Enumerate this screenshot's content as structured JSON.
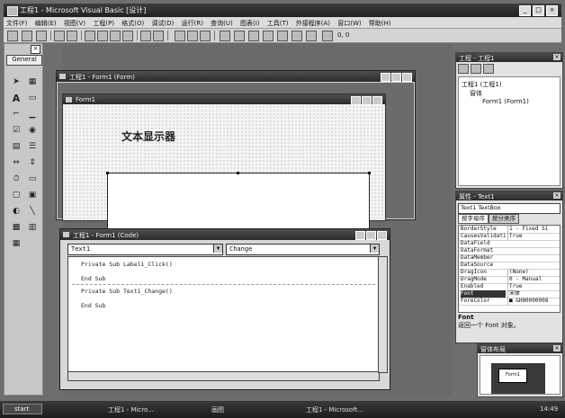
{
  "window": {
    "title": "工程1 - Microsoft Visual Basic [设计]",
    "controls": [
      "_",
      "□",
      "×"
    ]
  },
  "menu": [
    "文件(F)",
    "编辑(E)",
    "视图(V)",
    "工程(P)",
    "格式(O)",
    "调试(D)",
    "运行(R)",
    "查询(U)",
    "图表(I)",
    "工具(T)",
    "外接程序(A)",
    "窗口(W)",
    "帮助(H)"
  ],
  "toolbar": {
    "coords": "0, 0",
    "size": "1"
  },
  "toolbox": {
    "tab": "General",
    "close": "×"
  },
  "designer": {
    "title": "工程1 - Form1 (Form)",
    "form_title": "Form1",
    "label_text": "文本显示器"
  },
  "code": {
    "title": "工程1 - Form1 (Code)",
    "object": "Text1",
    "procedure": "Change",
    "lines": [
      "Private Sub Label1_Click()",
      "End Sub",
      "Private Sub Text1_Change()",
      "End Sub"
    ]
  },
  "project": {
    "title": "工程 - 工程1",
    "root": "工程1 (工程1)",
    "folder": "窗体",
    "item": "Form1 (Form1)"
  },
  "properties": {
    "title": "属性 - Text1",
    "object": "Text1 TextBox",
    "tabs": [
      "按字母序",
      "按分类序"
    ],
    "rows": [
      {
        "name": "BorderStyle",
        "value": "1 - Fixed Si"
      },
      {
        "name": "CausesValidati",
        "value": "True"
      },
      {
        "name": "DataField",
        "value": ""
      },
      {
        "name": "DataFormat",
        "value": ""
      },
      {
        "name": "DataMember",
        "value": ""
      },
      {
        "name": "DataSource",
        "value": ""
      },
      {
        "name": "DragIcon",
        "value": "(None)"
      },
      {
        "name": "DragMode",
        "value": "0 - Manual"
      },
      {
        "name": "Enabled",
        "value": "True"
      },
      {
        "name": "Font",
        "value": "宋体"
      },
      {
        "name": "ForeColor",
        "value": "■ &H80000008"
      }
    ],
    "desc_title": "Font",
    "desc_text": "返回一个 Font 对象。"
  },
  "layout": {
    "title": "窗体布局",
    "form_label": "Form1"
  },
  "taskbar": {
    "start": "start",
    "items": [
      "工程1 - Micro...",
      "画图",
      "工程1 - Microsoft..."
    ],
    "clock": "14:49"
  }
}
